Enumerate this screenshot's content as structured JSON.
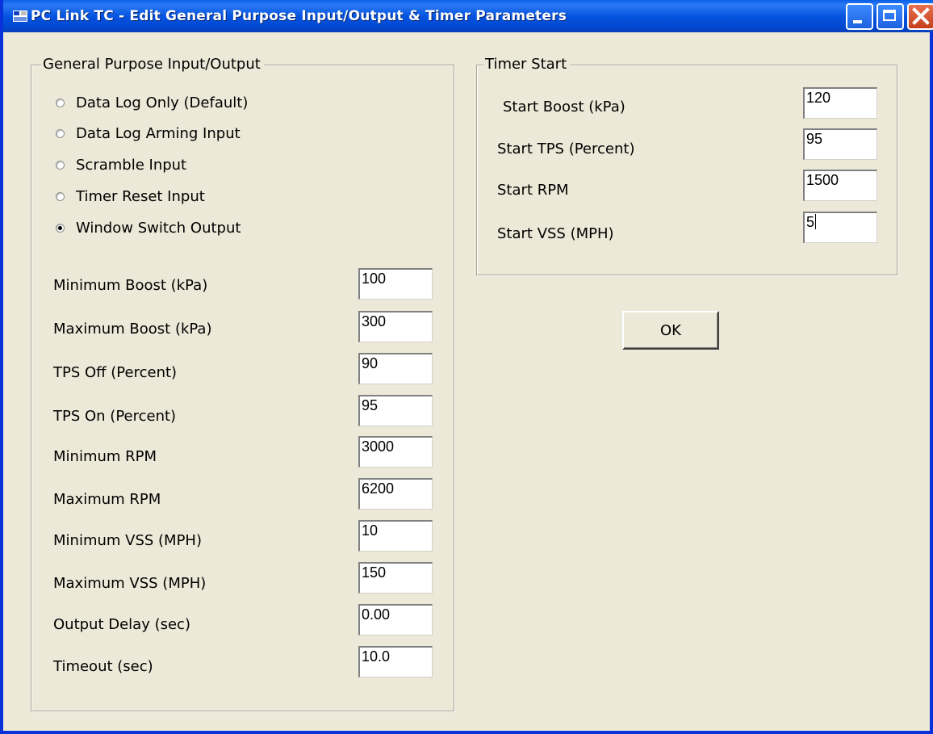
{
  "window": {
    "title": "PC Link TC - Edit General Purpose Input/Output & Timer Parameters",
    "icon": "app-icon",
    "controls": [
      "minimize-icon",
      "maximize-icon",
      "close-icon"
    ]
  },
  "gpio": {
    "legend": "General Purpose Input/Output",
    "options": [
      {
        "label": "Data Log Only (Default)",
        "selected": false
      },
      {
        "label": "Data Log Arming Input",
        "selected": false
      },
      {
        "label": "Scramble Input",
        "selected": false
      },
      {
        "label": "Timer Reset Input",
        "selected": false
      },
      {
        "label": "Window Switch Output",
        "selected": true
      }
    ],
    "fields": [
      {
        "label": "Minimum Boost (kPa)",
        "value": "100"
      },
      {
        "label": "Maximum Boost (kPa)",
        "value": "300"
      },
      {
        "label": "TPS Off (Percent)",
        "value": "90"
      },
      {
        "label": "TPS On (Percent)",
        "value": "95"
      },
      {
        "label": "Minimum RPM",
        "value": "3000"
      },
      {
        "label": "Maximum RPM",
        "value": "6200"
      },
      {
        "label": "Minimum VSS (MPH)",
        "value": "10"
      },
      {
        "label": "Maximum VSS (MPH)",
        "value": "150"
      },
      {
        "label": "Output Delay (sec)",
        "value": "0.00"
      },
      {
        "label": "Timeout (sec)",
        "value": "10.0"
      }
    ]
  },
  "timer": {
    "legend": "Timer Start",
    "fields": [
      {
        "label": "Start Boost (kPa)",
        "value": "120"
      },
      {
        "label": "Start TPS (Percent)",
        "value": "95"
      },
      {
        "label": "Start RPM",
        "value": "1500"
      },
      {
        "label": "Start VSS (MPH)",
        "value": "5"
      }
    ]
  },
  "ok_label": "OK"
}
